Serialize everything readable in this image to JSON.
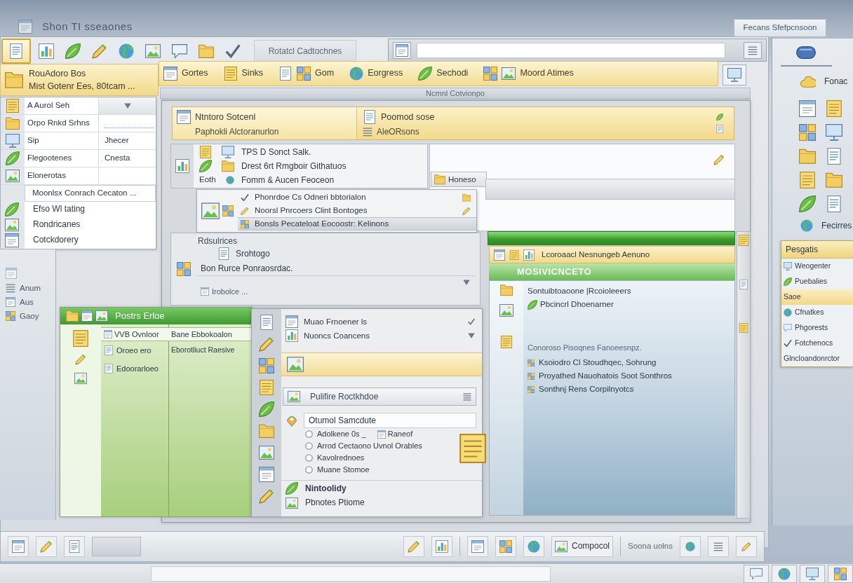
{
  "window": {
    "title": "Shon TI sseaones"
  },
  "top_tab": {
    "label": "Fecans Sfefpcnsoon"
  },
  "toolbar": {
    "buttons": [
      {
        "selected": true
      },
      {
        "selected": false
      },
      {
        "selected": false
      },
      {
        "selected": false
      },
      {
        "selected": false
      },
      {
        "selected": false
      },
      {
        "selected": false
      },
      {
        "selected": false
      },
      {
        "selected": false
      }
    ],
    "tab": "Rotatcl Cadtochnes"
  },
  "ribbon": {
    "panel_lines": [
      "RouAdoro Bos",
      "Mist Gotenr Ees, 80tcam ..."
    ],
    "items": [
      {
        "label": "Gortes"
      },
      {
        "label": "Sinks"
      },
      {
        "label": "Gom"
      },
      {
        "label": "Eorgress"
      },
      {
        "label": "Sechodi"
      },
      {
        "label": "Moord Atimes"
      }
    ]
  },
  "section_title": "Ncmnl Cotvionpo",
  "options_panel": {
    "rows": [
      {
        "kind": "dropdown",
        "label": "A Aurol Seh"
      },
      {
        "kind": "field",
        "label": "Orpo Rnkd Srhns"
      },
      {
        "kind": "text",
        "label": "Sip",
        "value": "Jhecer"
      },
      {
        "kind": "text",
        "label": "Flegootenes",
        "value": "Cnesta"
      },
      {
        "kind": "text",
        "label": "Elonerotas"
      }
    ],
    "search_row": "Moonlsx Conrach Cecaton ...",
    "items": [
      "Efso Wl tating",
      "Rondricanes",
      "Cotckdorery"
    ]
  },
  "sidebar": {
    "items": [
      "Anum",
      "Aus",
      "Gaoy"
    ]
  },
  "document": {
    "header": {
      "title": "Ntntoro Sotcenl",
      "subtitle": "Paphokli Alctoranurlon",
      "side_title": "Poomod sose",
      "side_subtitle": "AleORsons"
    },
    "list": [
      {
        "text": "TPS D Sonct Salk."
      },
      {
        "text": "Drest 6rt Rmgboir Githatuos"
      },
      {
        "label": "Eoth",
        "text": "Fomm & Aucen Feoceon"
      }
    ],
    "sub_items": [
      {
        "text": "Phonrdoe Cs Odneri bbtorialon",
        "selected": false
      },
      {
        "text": "Noorsl Pnrcoers Clint Bontoges",
        "selected": false
      },
      {
        "text": "Bonsls Pecateloat Eocoostr: Kelinons",
        "selected": true
      }
    ],
    "results": {
      "title": "Rdsulrices",
      "item": "Srohtogo",
      "note": "Bon Rurce Ponraosrdac.",
      "footer": "Irobolce ..."
    }
  },
  "preview": {
    "tab": "Honeso",
    "banner": "Lcoroaacl Nesnungeb Aenuno",
    "heading": "MOSIVICNCETO",
    "lines": [
      "Sontuibtoaoone |Rcoioleeers",
      "Pbcincrl Dhoenarner"
    ],
    "paragraph": "Conoroso Pisoqnes Fanoeesnpz.",
    "items": [
      "Ksoiodro Cl Stoudhqec, Sohrung",
      "Proyathed Nauohatois Soot Sonthros",
      "Sonthnj Rens Corpilnyotcs"
    ]
  },
  "green_panel": {
    "title": "Postrs Erloe",
    "columns": [
      "VVB Ovnloor",
      "Bane Ebbokoalon"
    ],
    "rows": [
      [
        "Oroeo ero",
        "Eborotliuct Raesive"
      ],
      [
        "Edoorarloeo"
      ]
    ]
  },
  "menu_panel": {
    "items": [
      "Muao Frnoener ls",
      "Nuoncs Coancens"
    ],
    "field": "Pulifire Roctkhdoe",
    "group_title": "Otumol Samcdute",
    "options": [
      {
        "label": "Adolkene 0s _",
        "selected": false
      },
      {
        "label": "Arrod Cectaono Uvnol Orables",
        "selected": false
      },
      {
        "label": "Kavolrednoes",
        "selected": false
      },
      {
        "label": "Muane Stomoe",
        "selected": false
      }
    ],
    "option_tag": "Raneof",
    "footer_heading": "Nintoolidy",
    "footer_item": "Pbnotes Ptiome"
  },
  "right_sidebar": {
    "label": "Fonac",
    "caption": "Fecirres",
    "group": {
      "title": "Pesgatis",
      "items": [
        {
          "label": "Weogenter",
          "selected": false
        },
        {
          "label": "Puebalies",
          "selected": false
        },
        {
          "label": "Saoe",
          "selected": true
        },
        {
          "label": "Cfnatkes",
          "selected": false
        },
        {
          "label": "Phgorests",
          "selected": false
        },
        {
          "label": "Fotchenocs",
          "selected": false
        },
        {
          "label": "Glncloandonrctor",
          "selected": false
        }
      ]
    }
  },
  "bottom_toolbar": {
    "button": "Compocol",
    "label": "Soona uolns"
  }
}
